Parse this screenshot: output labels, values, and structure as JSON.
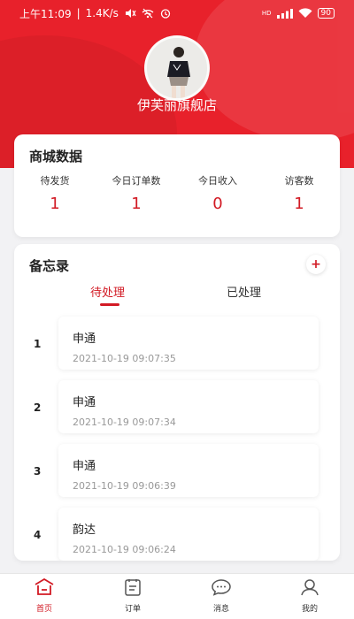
{
  "status_bar": {
    "time": "上午11:09",
    "separator": "|",
    "speed": "1.4K/s",
    "signal_label": "HD",
    "battery": "90"
  },
  "store": {
    "name": "伊芙丽旗舰店"
  },
  "stats": {
    "title": "商城数据",
    "items": [
      {
        "label": "待发货",
        "value": "1"
      },
      {
        "label": "今日订单数",
        "value": "1"
      },
      {
        "label": "今日收入",
        "value": "0"
      },
      {
        "label": "访客数",
        "value": "1"
      }
    ]
  },
  "memo": {
    "title": "备忘录",
    "add_label": "+",
    "tabs": [
      {
        "label": "待处理",
        "active": true
      },
      {
        "label": "已处理",
        "active": false
      }
    ],
    "items": [
      {
        "index": "1",
        "courier": "申通",
        "time": "2021-10-19 09:07:35"
      },
      {
        "index": "2",
        "courier": "申通",
        "time": "2021-10-19 09:07:34"
      },
      {
        "index": "3",
        "courier": "申通",
        "time": "2021-10-19 09:06:39"
      },
      {
        "index": "4",
        "courier": "韵达",
        "time": "2021-10-19 09:06:24"
      }
    ]
  },
  "nav": {
    "items": [
      {
        "label": "首页",
        "icon": "home-icon",
        "active": true
      },
      {
        "label": "订单",
        "icon": "order-icon",
        "active": false
      },
      {
        "label": "消息",
        "icon": "message-icon",
        "active": false
      },
      {
        "label": "我的",
        "icon": "profile-icon",
        "active": false
      }
    ]
  },
  "colors": {
    "brand_red": "#e8212b",
    "accent_red": "#d21a24"
  }
}
